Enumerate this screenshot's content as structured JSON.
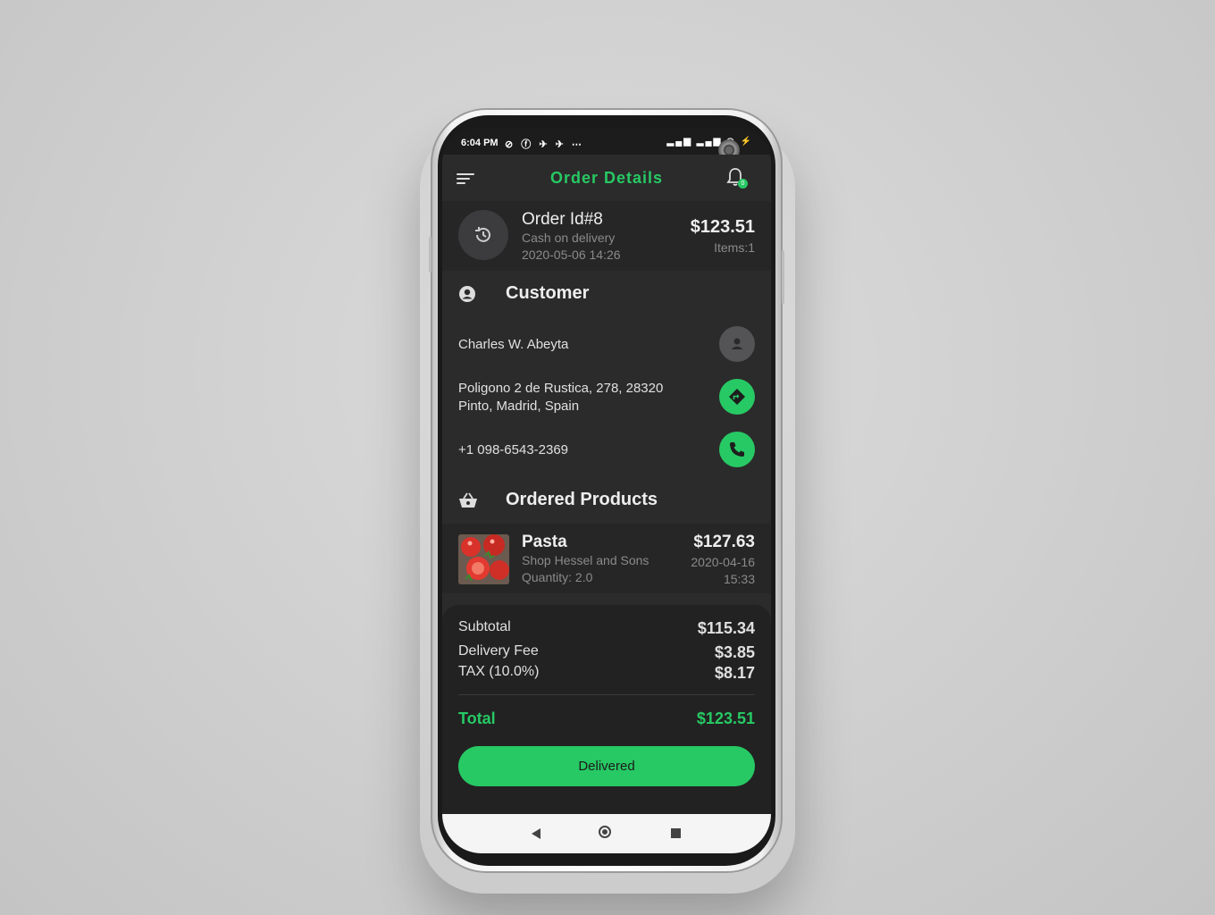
{
  "status_bar": {
    "time": "6:04 PM",
    "left_icons": "⊘ ⓕ ✈ ✈ ⋯",
    "right_icons": "▂▄▆ ▂▄▆ ◠ ⚡"
  },
  "app_bar": {
    "title": "Order Details",
    "notification_count": "0"
  },
  "order": {
    "id_label": "Order Id#8",
    "payment": "Cash on delivery",
    "date": "2020-05-06 14:26",
    "total": "$123.51",
    "items": "Items:1"
  },
  "customer": {
    "section_title": "Customer",
    "name": "Charles W. Abeyta",
    "address_line1": "Poligono 2 de Rustica, 278, 28320",
    "address_line2": "Pinto, Madrid, Spain",
    "phone": "+1 098-6543-2369"
  },
  "products": {
    "section_title": "Ordered Products",
    "items": [
      {
        "name": "Pasta",
        "shop": "Shop Hessel and Sons",
        "quantity": "Quantity: 2.0",
        "price": "$127.63",
        "date": "2020-04-16",
        "time": "15:33"
      }
    ]
  },
  "summary": {
    "subtotal_label": "Subtotal",
    "subtotal_value": "$115.34",
    "delivery_label": "Delivery Fee",
    "delivery_value": "$3.85",
    "tax_label": "TAX (10.0%)",
    "tax_value": "$8.17",
    "total_label": "Total",
    "total_value": "$123.51",
    "button_label": "Delivered"
  },
  "colors": {
    "accent": "#27c964",
    "background": "#2b2b2b",
    "card": "#262626"
  }
}
